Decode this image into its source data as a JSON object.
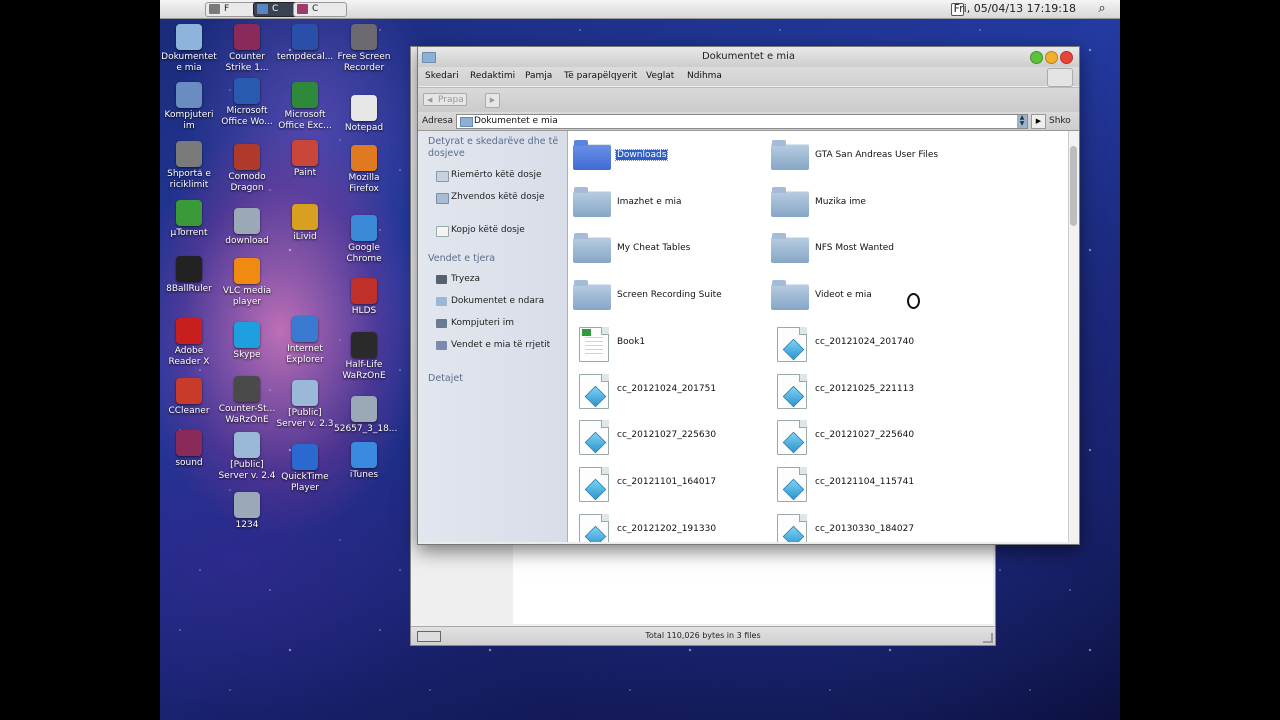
{
  "menubar": {
    "tasks": [
      {
        "label": "F",
        "color": "#7a7a7a"
      },
      {
        "label": "C",
        "color": "#5a86c0"
      },
      {
        "label": "C",
        "color": "#9e3b6a"
      }
    ],
    "clock": "Fri, 05/04/13 17:19:18"
  },
  "desktop_icons": [
    {
      "label": "Dokumentet e mia",
      "icon": "folder-icon",
      "color": "#8eb4dc"
    },
    {
      "label": "Counter Strike 1...",
      "icon": "winrar-icon",
      "color": "#8a2a5a"
    },
    {
      "label": "tempdecal...",
      "icon": "halflife-icon",
      "color": "#2a4fa8"
    },
    {
      "label": "Free Screen Recorder",
      "icon": "camera-icon",
      "color": "#6a6a70"
    },
    {
      "label": "Kompjuteri im",
      "icon": "computer-icon",
      "color": "#6a8cc0"
    },
    {
      "label": "Microsoft Office Wo...",
      "icon": "word-icon",
      "color": "#2a5ab0"
    },
    {
      "label": "Microsoft Office Exc...",
      "icon": "excel-icon",
      "color": "#2e8a3a"
    },
    {
      "label": "Notepad",
      "icon": "notepad-icon",
      "color": "#e6e6e6"
    },
    {
      "label": "Shporta e riciklimit",
      "icon": "trash-icon",
      "color": "#7a7a7a"
    },
    {
      "label": "Comodo Dragon",
      "icon": "comodo-icon",
      "color": "#b03a2a"
    },
    {
      "label": "Paint",
      "icon": "paint-icon",
      "color": "#c8463a"
    },
    {
      "label": "Mozilla Firefox",
      "icon": "firefox-icon",
      "color": "#e07a20"
    },
    {
      "label": "µTorrent",
      "icon": "utorrent-icon",
      "color": "#3a9a3a"
    },
    {
      "label": "download",
      "icon": "screen-icon",
      "color": "#9aa8b8"
    },
    {
      "label": "iLivid",
      "icon": "ilivid-icon",
      "color": "#d8a020"
    },
    {
      "label": "Google Chrome",
      "icon": "chrome-icon",
      "color": "#3a8ad8"
    },
    {
      "label": "8BallRuler",
      "icon": "ball-icon",
      "color": "#222222"
    },
    {
      "label": "VLC media player",
      "icon": "vlc-icon",
      "color": "#f08a10"
    },
    {
      "label": "HLDS",
      "icon": "halflife-icon",
      "color": "#c0302a"
    },
    {
      "label": "Adobe Reader X",
      "icon": "pdf-icon",
      "color": "#c81e1e"
    },
    {
      "label": "Skype",
      "icon": "skype-icon",
      "color": "#1ea0e0"
    },
    {
      "label": "Internet Explorer",
      "icon": "ie-icon",
      "color": "#3a7ad0"
    },
    {
      "label": "Half-Life WaRzOnE",
      "icon": "halflife-icon",
      "color": "#2a2a2a"
    },
    {
      "label": "CCleaner",
      "icon": "ccleaner-icon",
      "color": "#c83a2a"
    },
    {
      "label": "Counter-St... WaRzOnE",
      "icon": "cs-icon",
      "color": "#4a4a4a"
    },
    {
      "label": "[Public] Server v. 2.3",
      "icon": "folder-icon",
      "color": "#9ab8d8"
    },
    {
      "label": "52657_3_18...",
      "icon": "screen-icon",
      "color": "#9aa8b8"
    },
    {
      "label": "sound",
      "icon": "winrar-icon",
      "color": "#8a2a5a"
    },
    {
      "label": "[Public] Server v. 2.4",
      "icon": "folder-icon",
      "color": "#9ab8d8"
    },
    {
      "label": "QuickTime Player",
      "icon": "quicktime-icon",
      "color": "#2a6ad0"
    },
    {
      "label": "iTunes",
      "icon": "itunes-icon",
      "color": "#3a8ae0"
    },
    {
      "label": "1234",
      "icon": "screen-icon",
      "color": "#9aa8b8"
    }
  ],
  "window": {
    "title": "Dokumentet e mia",
    "menu": [
      "Skedari",
      "Redaktimi",
      "Pamja",
      "Të parapëlqyerit",
      "Veglat",
      "Ndihma"
    ],
    "back_label": "Prapa",
    "address_label": "Adresa",
    "address_value": "Dokumentet e mia",
    "go_label": "Shko",
    "sidebar": {
      "tasks_header": "Detyrat e skedarëve dhe të dosjeve",
      "tasks": [
        "Riemërto këtë dosje",
        "Zhvendos këtë dosje",
        "Kopjo këtë dosje"
      ],
      "places_header": "Vendet e tjera",
      "places": [
        "Tryeza",
        "Dokumentet e ndara",
        "Kompjuteri im",
        "Vendet e mia të rrjetit"
      ],
      "details_header": "Detajet"
    },
    "files": [
      {
        "name": "Downloads",
        "type": "folder",
        "selected": true
      },
      {
        "name": "GTA San Andreas User Files",
        "type": "folder"
      },
      {
        "name": "Imazhet e mia",
        "type": "folder"
      },
      {
        "name": "Muzika ime",
        "type": "folder"
      },
      {
        "name": "My Cheat Tables",
        "type": "folder"
      },
      {
        "name": "NFS Most Wanted",
        "type": "folder"
      },
      {
        "name": "Screen Recording Suite",
        "type": "folder"
      },
      {
        "name": "Videot e mia",
        "type": "folder"
      },
      {
        "name": "Book1",
        "type": "spreadsheet"
      },
      {
        "name": "cc_20121024_201740",
        "type": "cube"
      },
      {
        "name": "cc_20121024_201751",
        "type": "cube"
      },
      {
        "name": "cc_20121025_221113",
        "type": "cube"
      },
      {
        "name": "cc_20121027_225630",
        "type": "cube"
      },
      {
        "name": "cc_20121027_225640",
        "type": "cube"
      },
      {
        "name": "cc_20121101_164017",
        "type": "cube"
      },
      {
        "name": "cc_20121104_115741",
        "type": "cube"
      },
      {
        "name": "cc_20121202_191330",
        "type": "cube"
      },
      {
        "name": "cc_20130330_184027",
        "type": "cube"
      }
    ]
  },
  "back_window": {
    "status_text": "Total 110,026 bytes in 3 files"
  }
}
